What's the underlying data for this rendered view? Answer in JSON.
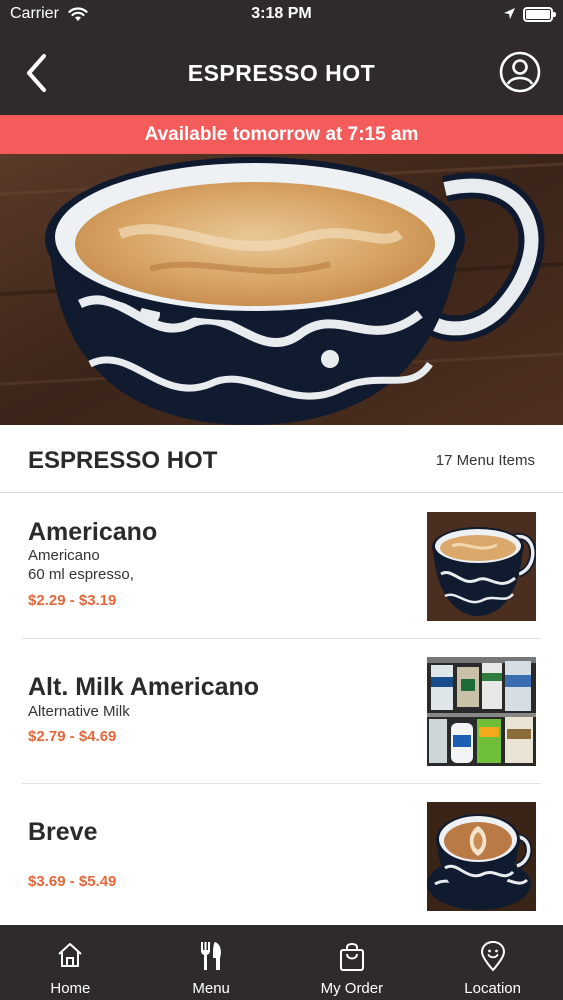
{
  "status_bar": {
    "carrier": "Carrier",
    "time": "3:18 PM"
  },
  "nav": {
    "title": "ESPRESSO HOT",
    "back_icon": "chevron-left-icon",
    "profile_icon": "user-circle-icon"
  },
  "banner": {
    "text": "Available tomorrow at 7:15 am",
    "color": "#f45b5b"
  },
  "section": {
    "title": "ESPRESSO HOT",
    "count": "17 Menu Items"
  },
  "items": [
    {
      "name": "Americano",
      "description": [
        "Americano",
        "60 ml espresso,"
      ],
      "price": "$2.29 - $3.19",
      "thumb": "latte-cup-photo"
    },
    {
      "name": "Alt. Milk Americano",
      "description": [
        "Alternative Milk"
      ],
      "price": "$2.79 - $4.69",
      "thumb": "milk-cartons-photo"
    },
    {
      "name": "Breve",
      "description": [],
      "price": "$3.69 - $5.49",
      "thumb": "latte-art-cup-photo"
    }
  ],
  "tabs": [
    {
      "label": "Home",
      "icon": "home-icon"
    },
    {
      "label": "Menu",
      "icon": "fork-knife-icon"
    },
    {
      "label": "My Order",
      "icon": "shopping-bag-icon"
    },
    {
      "label": "Location",
      "icon": "location-pin-icon"
    }
  ],
  "colors": {
    "bar": "#2f2b2b",
    "price": "#e4673a"
  }
}
